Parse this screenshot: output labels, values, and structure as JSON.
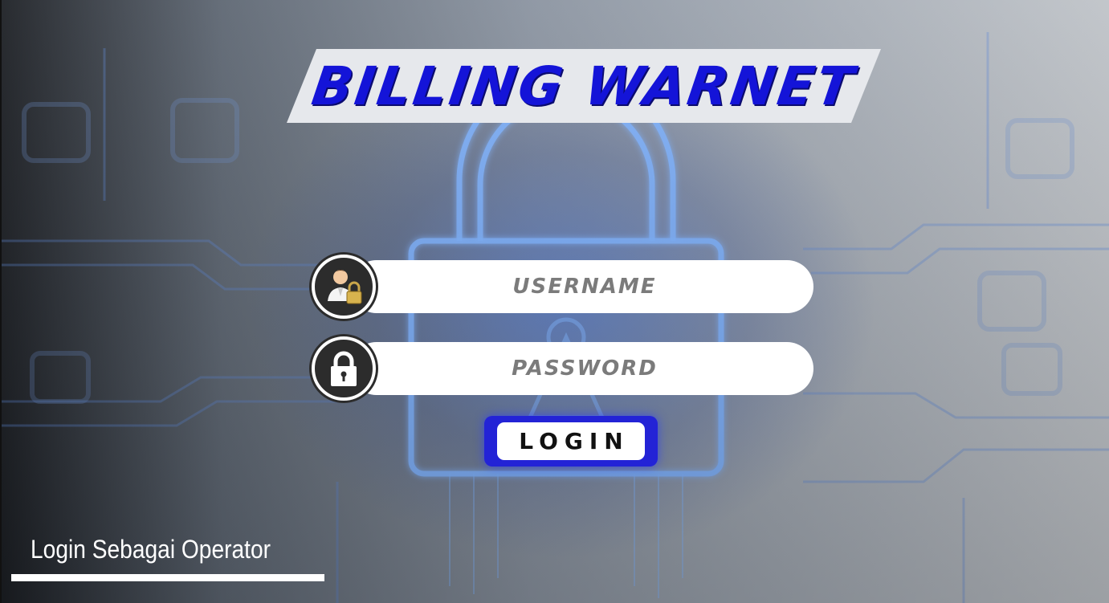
{
  "app": {
    "title": "BILLING WARNET"
  },
  "login_form": {
    "username_placeholder": "USERNAME",
    "password_placeholder": "PASSWORD",
    "login_button_label": "LOGIN"
  },
  "footer": {
    "operator_link_label": "Login Sebagai Operator"
  },
  "icons": {
    "username_icon": "user-lock-icon",
    "password_icon": "padlock-icon"
  },
  "colors": {
    "brand_blue": "#1414d8",
    "button_blue": "#2323d6",
    "placeholder_gray": "#7b7b7b",
    "neon_glow": "#6aa8ff"
  }
}
